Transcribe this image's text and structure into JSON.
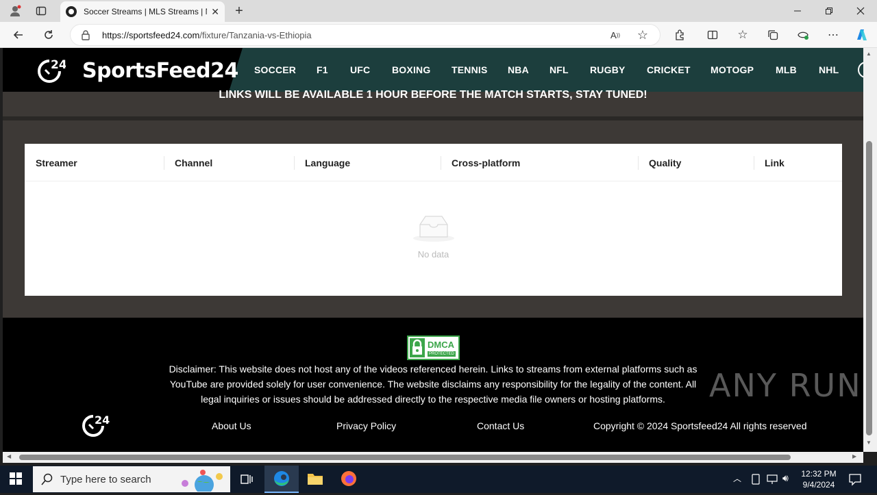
{
  "browser": {
    "tab_title": "Soccer Streams | MLS Streams | N",
    "url_host": "https://sportsfeed24.com",
    "url_path": "/fixture/Tanzania-vs-Ethiopia"
  },
  "site": {
    "logo_text_a": "Sports",
    "logo_text_b": "Feed24",
    "nav": [
      "SOCCER",
      "F1",
      "UFC",
      "BOXING",
      "TENNIS",
      "NBA",
      "NFL",
      "RUGBY",
      "CRICKET",
      "MOTOGP",
      "MLB",
      "NHL"
    ],
    "banner": "LINKS WILL BE AVAILABLE 1 HOUR BEFORE THE MATCH STARTS, STAY TUNED!"
  },
  "table": {
    "headers": [
      "Streamer",
      "Channel",
      "Language",
      "Cross-platform",
      "Quality",
      "Link"
    ],
    "empty_text": "No data"
  },
  "footer": {
    "dmca_title": "DMCA",
    "dmca_sub": "PROTECTED",
    "disclaimer": "Disclaimer: This website does not host any of the videos referenced herein. Links to streams from external platforms such as YouTube are provided solely for user convenience. The website disclaims any responsibility for the legality of the content. All legal inquiries or issues should be addressed directly to the respective media file owners or hosting platforms.",
    "links": [
      "About Us",
      "Privacy Policy",
      "Contact Us"
    ],
    "copyright": "Copyright © 2024 Sportsfeed24 All rights reserved"
  },
  "watermark": "ANY RUN",
  "taskbar": {
    "search_placeholder": "Type here to search",
    "time": "12:32 PM",
    "date": "9/4/2024"
  }
}
